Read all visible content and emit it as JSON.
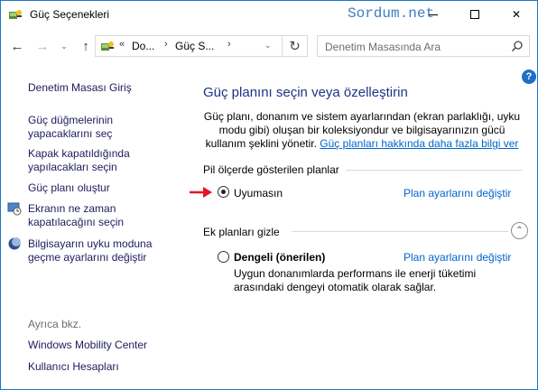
{
  "window": {
    "title": "Güç Seçenekleri",
    "watermark": "Sordum.net",
    "minimize_label": "—",
    "close_label": "✕"
  },
  "nav": {
    "back": "←",
    "forward": "→",
    "recent": "⌄",
    "up": "↑",
    "address_prefix": "«",
    "address_seg1": "Do...",
    "address_sep": "›",
    "address_seg2": "Güç S...",
    "address_drop": "⌄",
    "refresh": "↻",
    "search_placeholder": "Denetim Masasında Ara"
  },
  "help_label": "?",
  "sidebar": {
    "home": "Denetim Masası Giriş",
    "items": [
      {
        "label_line1": "Güç düğmelerinin",
        "label_line2": "yapacaklarını seç"
      },
      {
        "label_line1": "Kapak kapatıldığında",
        "label_line2": "yapılacakları seçin"
      },
      {
        "label_line1": "Güç planı oluştur",
        "label_line2": ""
      },
      {
        "label_line1": "Ekranın ne zaman",
        "label_line2": "kapatılacağını seçin",
        "icon": "clock-monitor-icon"
      },
      {
        "label_line1": "Bilgisayarın uyku moduna",
        "label_line2": "geçme ayarlarını değiştir",
        "icon": "moon-icon"
      }
    ],
    "see_also": "Ayrıca bkz.",
    "see_also_links": [
      "Windows Mobility Center",
      "Kullanıcı Hesapları"
    ]
  },
  "main": {
    "heading": "Güç planını seçin veya özelleştirin",
    "desc_line1": "Güç planı, donanım ve sistem ayarlarından (ekran parlaklığı, uyku",
    "desc_line2": "modu gibi) oluşan bir koleksiyondur ve bilgisayarınızın gücü",
    "desc_line3": "kullanım şeklini yönetir.",
    "desc_link": "Güç planları hakkında daha fazla bilgi ver",
    "battery_section": "Pil ölçerde gösterilen planlar",
    "plan1": {
      "name": "Uyumasın",
      "link": "Plan ayarlarını değiştir",
      "selected": true
    },
    "extra_section": "Ek planları gizle",
    "collapse_icon": "⌃",
    "plan2": {
      "name": "Dengeli (önerilen)",
      "link": "Plan ayarlarını değiştir",
      "selected": false,
      "desc_line1": "Uygun donanımlarda performans ile enerji tüketimi",
      "desc_line2": "arasındaki dengeyi otomatik olarak sağlar."
    },
    "annotation_color": "#e81123"
  }
}
